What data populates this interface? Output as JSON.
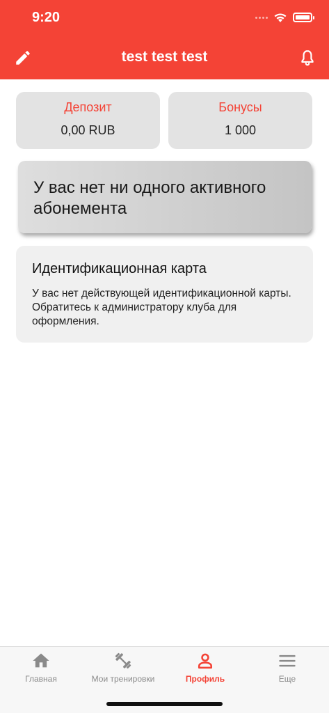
{
  "status_bar": {
    "time": "9:20"
  },
  "app_bar": {
    "title": "test test test",
    "edit_icon": "pencil-icon",
    "bell_icon": "bell-icon"
  },
  "balances": {
    "deposit": {
      "label": "Депозит",
      "value": "0,00 RUB"
    },
    "bonus": {
      "label": "Бонусы",
      "value": "1 000"
    }
  },
  "subscription": {
    "message": "У вас нет ни одного активного абонемента"
  },
  "id_card": {
    "title": "Идентификационная карта",
    "text": "У вас нет действующей идентификационной карты. Обратитесь к администратору клуба для оформления."
  },
  "tabs": [
    {
      "label": "Главная",
      "icon": "home-icon",
      "active": false
    },
    {
      "label": "Мои тренировки",
      "icon": "dumbbell-icon",
      "active": false
    },
    {
      "label": "Профиль",
      "icon": "user-icon",
      "active": true
    },
    {
      "label": "Еще",
      "icon": "menu-icon",
      "active": false
    }
  ],
  "colors": {
    "accent": "#F44336",
    "inactive_tab": "#8a8a8a"
  }
}
